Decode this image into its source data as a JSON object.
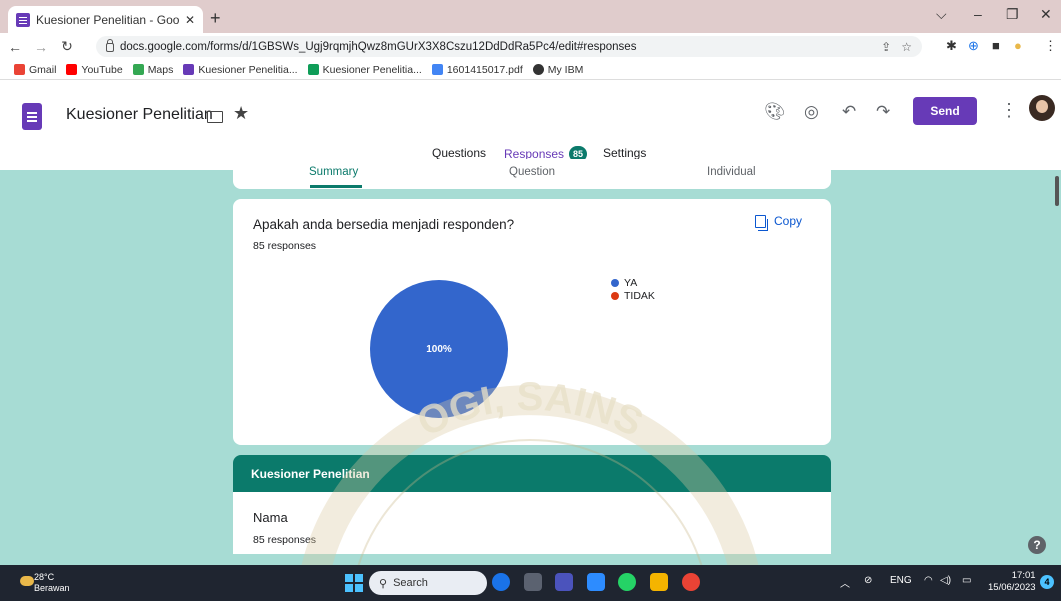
{
  "browser": {
    "tab_title": "Kuesioner Penelitian - Google Fo",
    "tab_close": "✕",
    "new_tab": "+",
    "url": "docs.google.com/forms/d/1GBSWs_Ugj9rqmjhQwz8mGUrX3X8Cszu12DdDdRa5Pc4/edit#responses",
    "bookmarks": [
      {
        "label": "Gmail",
        "color": "#ea4335"
      },
      {
        "label": "YouTube",
        "color": "#ff0000"
      },
      {
        "label": "Maps",
        "color": "#34a853"
      },
      {
        "label": "Kuesioner Penelitia...",
        "color": "#673ab7"
      },
      {
        "label": "Kuesioner Penelitia...",
        "color": "#0f9d58"
      },
      {
        "label": "1601415017.pdf",
        "color": "#4285f4"
      },
      {
        "label": "My IBM",
        "color": "#333333"
      }
    ]
  },
  "header": {
    "form_title": "Kuesioner Penelitian",
    "send_label": "Send",
    "tabs": {
      "questions": "Questions",
      "responses": "Responses",
      "responses_count": "85",
      "settings": "Settings"
    }
  },
  "subtabs": {
    "summary": "Summary",
    "question": "Question",
    "individual": "Individual"
  },
  "question_card": {
    "title": "Apakah anda bersedia menjadi responden?",
    "responses": "85 responses",
    "copy_label": "Copy"
  },
  "chart_data": {
    "type": "pie",
    "slices": [
      {
        "label": "YA",
        "value": 100,
        "color": "#3366cc"
      },
      {
        "label": "TIDAK",
        "value": 0,
        "color": "#dc3912"
      }
    ],
    "data_label": "100%"
  },
  "section": {
    "title_bold": "Kuesioner Penelitian"
  },
  "name_card": {
    "title": "Nama",
    "responses": "85 responses"
  },
  "taskbar": {
    "temperature": "28°C",
    "weather": "Berawan",
    "search": "Search",
    "lang": "ENG",
    "time": "17:01",
    "date": "15/06/2023",
    "notif_count": "4"
  },
  "watermark_text": "OGI, SAINS"
}
